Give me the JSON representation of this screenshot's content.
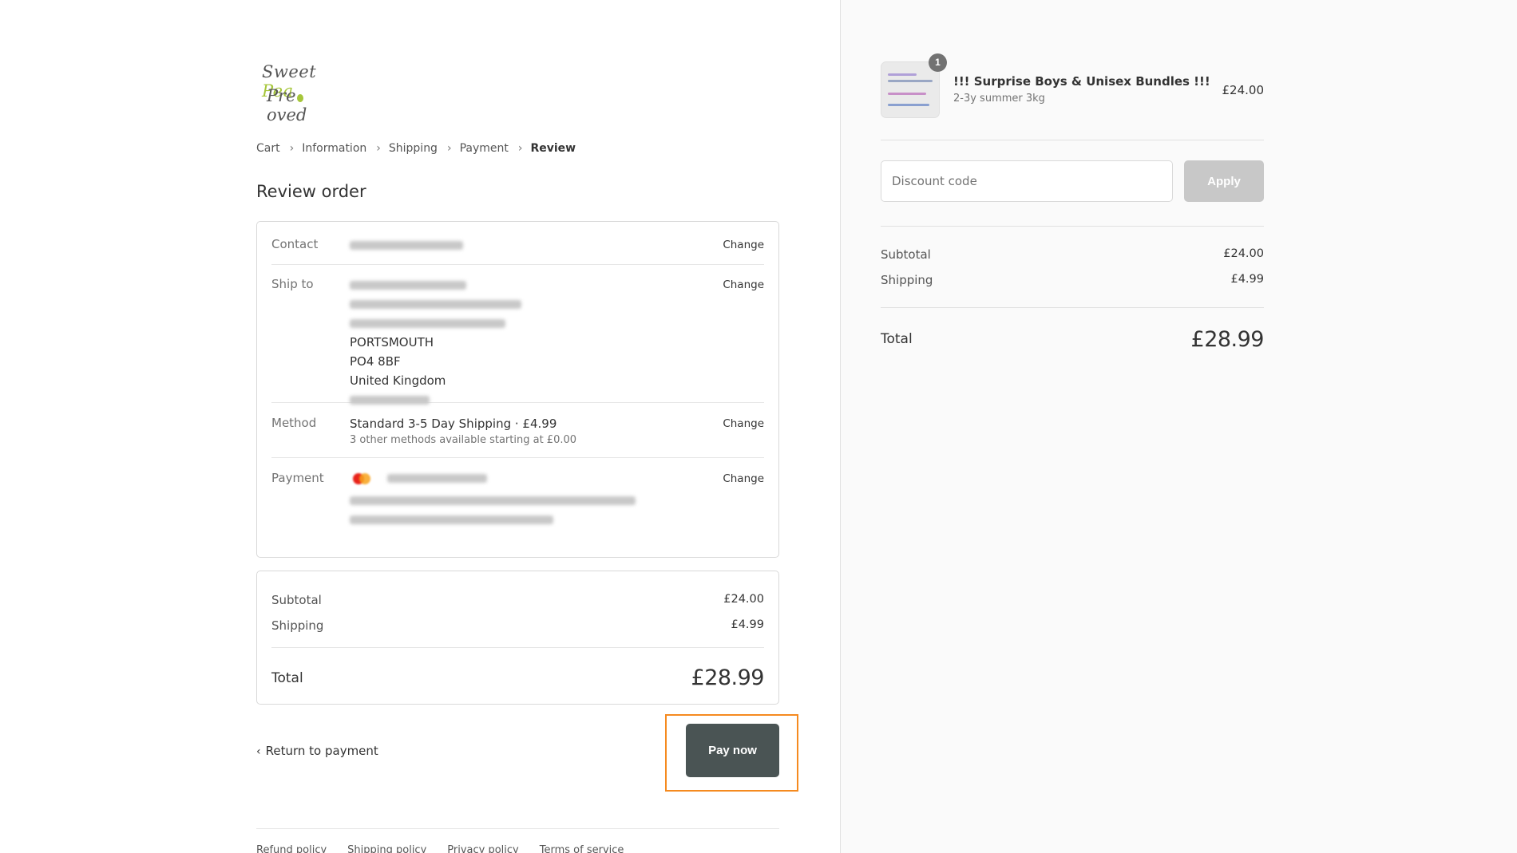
{
  "logo": {
    "line1_a": "Sweet ",
    "line1_b": "Pea",
    "line2_a": "Pre",
    "line2_b": "oved"
  },
  "breadcrumb": {
    "items": [
      "Cart",
      "Information",
      "Shipping",
      "Payment"
    ],
    "current": "Review"
  },
  "review": {
    "title": "Review order",
    "contact": {
      "label": "Contact",
      "change": "Change"
    },
    "ship_to": {
      "label": "Ship to",
      "change": "Change",
      "city": "PORTSMOUTH",
      "postcode": "PO4 8BF",
      "country": "United Kingdom"
    },
    "method": {
      "label": "Method",
      "change": "Change",
      "name": "Standard 3-5 Day Shipping",
      "separator": " · ",
      "price": "£4.99",
      "note": "3 other methods available starting at £0.00"
    },
    "payment": {
      "label": "Payment",
      "change": "Change"
    }
  },
  "summary": {
    "subtotal_label": "Subtotal",
    "subtotal": "£24.00",
    "shipping_label": "Shipping",
    "shipping": "£4.99",
    "total_label": "Total",
    "total": "£28.99"
  },
  "actions": {
    "return": "Return to payment",
    "pay": "Pay now"
  },
  "footer": {
    "links": [
      "Refund policy",
      "Shipping policy",
      "Privacy policy",
      "Terms of service"
    ]
  },
  "cart": {
    "product": {
      "name": "!!! Surprise Boys & Unisex Bundles !!!",
      "variant": "2-3y summer 3kg",
      "price": "£24.00",
      "quantity": "1"
    },
    "discount_placeholder": "Discount code",
    "apply": "Apply",
    "subtotal_label": "Subtotal",
    "subtotal": "£24.00",
    "shipping_label": "Shipping",
    "shipping": "£4.99",
    "total_label": "Total",
    "total": "£28.99"
  },
  "colors": {
    "pay_button": "#4a5454",
    "highlight": "#f58a1f",
    "logo_accent": "#a6c63a"
  }
}
